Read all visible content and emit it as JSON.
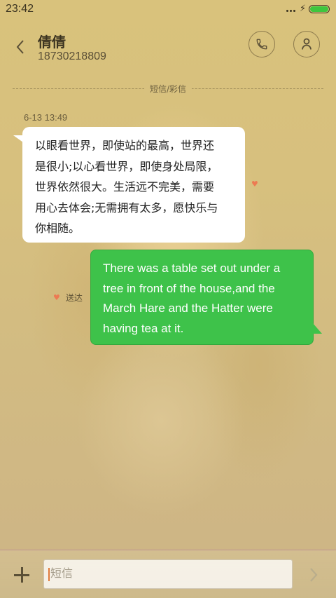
{
  "status_bar": {
    "time": "23:42",
    "battery_level": 1.0,
    "battery_color": "#3ec63e",
    "icons": [
      "signal-dots-icon",
      "charging-icon",
      "battery-icon"
    ]
  },
  "header": {
    "contact_name": "倩倩",
    "contact_number": "18730218809",
    "icons": [
      "back-chevron-icon",
      "phone-icon",
      "person-icon"
    ]
  },
  "conversation": {
    "divider_label": "短信/彩信",
    "timestamp": "6-13 13:49",
    "incoming_message": "以眼看世界，即使站的最高，世界还\n是很小;以心看世界，即使身处局限，\n世界依然很大。生活远不完美，需要\n用心去体会;无需拥有太多，愿快乐与\n你相随。",
    "outgoing_message": "There was a table set out under a\ntree in front of the house,and the\nMarch Hare and the Hatter were\nhaving tea at it.",
    "delivery_status": "送达",
    "colors": {
      "incoming_bubble": "#ffffff",
      "outgoing_bubble": "#3ec24a",
      "heart": "#ec7a52"
    }
  },
  "composer": {
    "placeholder": "短信",
    "value": "",
    "icons": [
      "add-icon",
      "send-arrow-icon"
    ]
  }
}
